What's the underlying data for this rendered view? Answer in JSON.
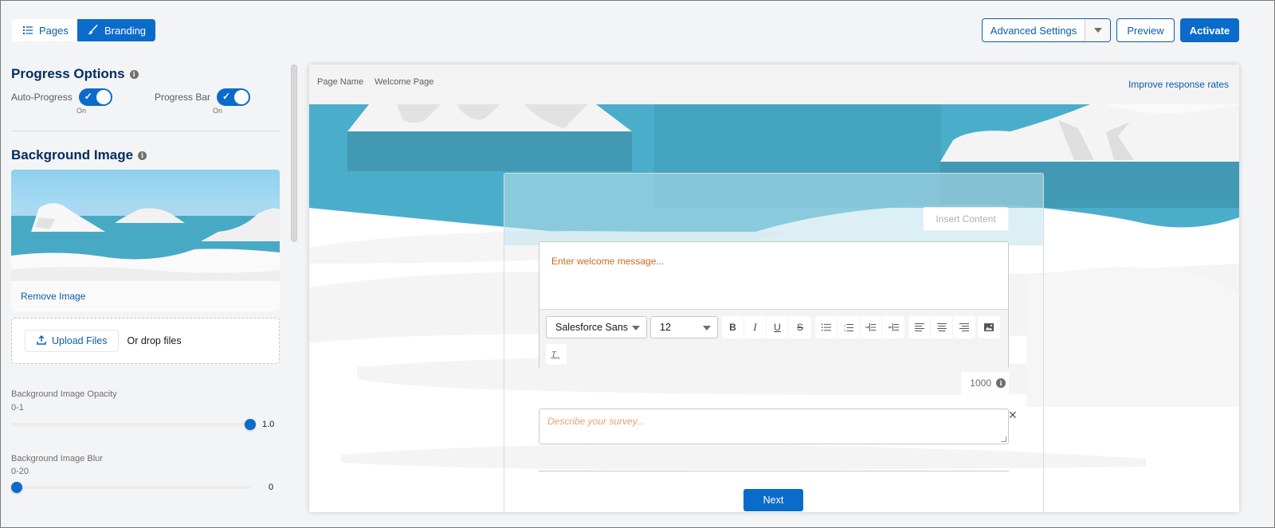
{
  "tabs": [
    {
      "label": "Pages",
      "icon": "list-icon",
      "active": false
    },
    {
      "label": "Branding",
      "icon": "brush-icon",
      "active": true
    }
  ],
  "header_actions": {
    "advanced_settings": "Advanced Settings",
    "preview": "Preview",
    "activate": "Activate"
  },
  "progress_options": {
    "title": "Progress Options",
    "auto_progress": {
      "label": "Auto-Progress",
      "state": "On",
      "enabled": true
    },
    "progress_bar": {
      "label": "Progress Bar",
      "state": "On",
      "enabled": true
    }
  },
  "background_image": {
    "title": "Background Image",
    "remove_label": "Remove Image",
    "upload_label": "Upload Files",
    "drop_label": "Or drop files",
    "opacity": {
      "label": "Background Image Opacity",
      "range": "0-1",
      "value": "1.0",
      "fraction": 1.0
    },
    "blur": {
      "label": "Background Image Blur",
      "range": "0-20",
      "value": "0",
      "fraction": 0.0
    }
  },
  "canvas": {
    "page_name_label": "Page Name",
    "page_name_value": "Welcome Page",
    "improve_link": "Improve response rates",
    "insert_content": "Insert Content",
    "welcome_placeholder": "Enter welcome message...",
    "font_family": "Salesforce Sans",
    "font_size": "12",
    "char_limit": "1000",
    "description_placeholder": "Describe your survey...",
    "next_label": "Next"
  },
  "colors": {
    "brand": "#0b6bcb",
    "link": "#0b5cab",
    "heading": "#032d60",
    "water": "#4aaecb"
  }
}
